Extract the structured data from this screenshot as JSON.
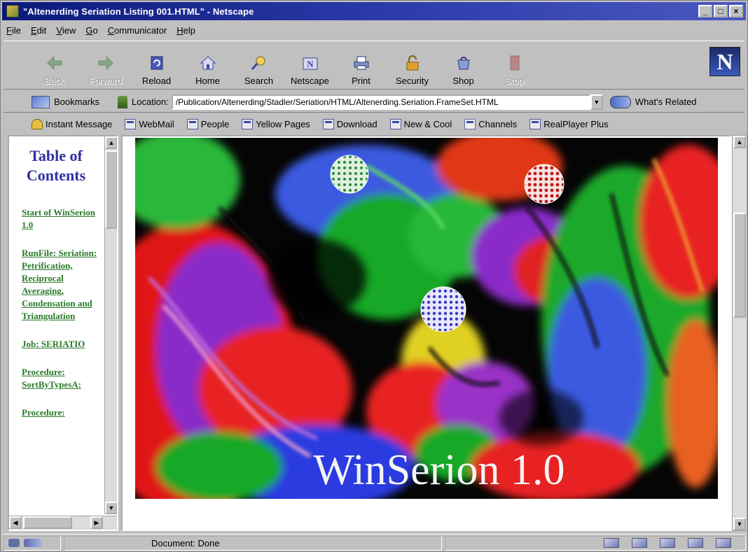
{
  "window": {
    "title": "\"Altenerding Seriation Listing 001.HTML\" - Netscape",
    "controls": {
      "minimize": "_",
      "maximize": "□",
      "close": "×"
    }
  },
  "menu": [
    "File",
    "Edit",
    "View",
    "Go",
    "Communicator",
    "Help"
  ],
  "toolbar": {
    "items": [
      {
        "label": "Back",
        "icon": "back-arrow-icon",
        "enabled": false
      },
      {
        "label": "Forward",
        "icon": "forward-arrow-icon",
        "enabled": false
      },
      {
        "label": "Reload",
        "icon": "reload-icon",
        "enabled": true
      },
      {
        "label": "Home",
        "icon": "home-icon",
        "enabled": true
      },
      {
        "label": "Search",
        "icon": "search-icon",
        "enabled": true
      },
      {
        "label": "Netscape",
        "icon": "netscape-icon",
        "enabled": true
      },
      {
        "label": "Print",
        "icon": "print-icon",
        "enabled": true
      },
      {
        "label": "Security",
        "icon": "lock-icon",
        "enabled": true
      },
      {
        "label": "Shop",
        "icon": "shop-icon",
        "enabled": true
      },
      {
        "label": "Stop",
        "icon": "stop-icon",
        "enabled": false
      }
    ],
    "logo": "N"
  },
  "location_bar": {
    "bookmarks_label": "Bookmarks",
    "location_label": "Location:",
    "url": "/Publication/Altenerding/Stadler/Seriation/HTML/Altenerding.Seriation.FrameSet.HTML",
    "related_label": "What's Related"
  },
  "personal_toolbar": [
    {
      "label": "Instant Message",
      "icon": "person-icon"
    },
    {
      "label": "WebMail",
      "icon": "bookmark-icon"
    },
    {
      "label": "People",
      "icon": "bookmark-icon"
    },
    {
      "label": "Yellow Pages",
      "icon": "bookmark-icon"
    },
    {
      "label": "Download",
      "icon": "bookmark-icon"
    },
    {
      "label": "New & Cool",
      "icon": "bookmark-icon"
    },
    {
      "label": "Channels",
      "icon": "channel-icon"
    },
    {
      "label": "RealPlayer Plus",
      "icon": "bookmark-icon"
    }
  ],
  "toc": {
    "title": "Table of Contents",
    "items": [
      "Start of WinSerion 1.0",
      "RunFile: Seriation: Petrification, Reciprocal Averaging, Condensation and Triangulation",
      "Job: SERIATIO",
      "Procedure: SortByTypesA:",
      "Procedure:"
    ]
  },
  "main": {
    "splash_text": "WinSerion 1.0"
  },
  "status": {
    "text": "Document: Done"
  },
  "colors": {
    "titlebar_start": "#0a1a7a",
    "toc_title": "#3030a0",
    "toc_link": "#2a7a2a",
    "chrome": "#c0c0c0"
  }
}
